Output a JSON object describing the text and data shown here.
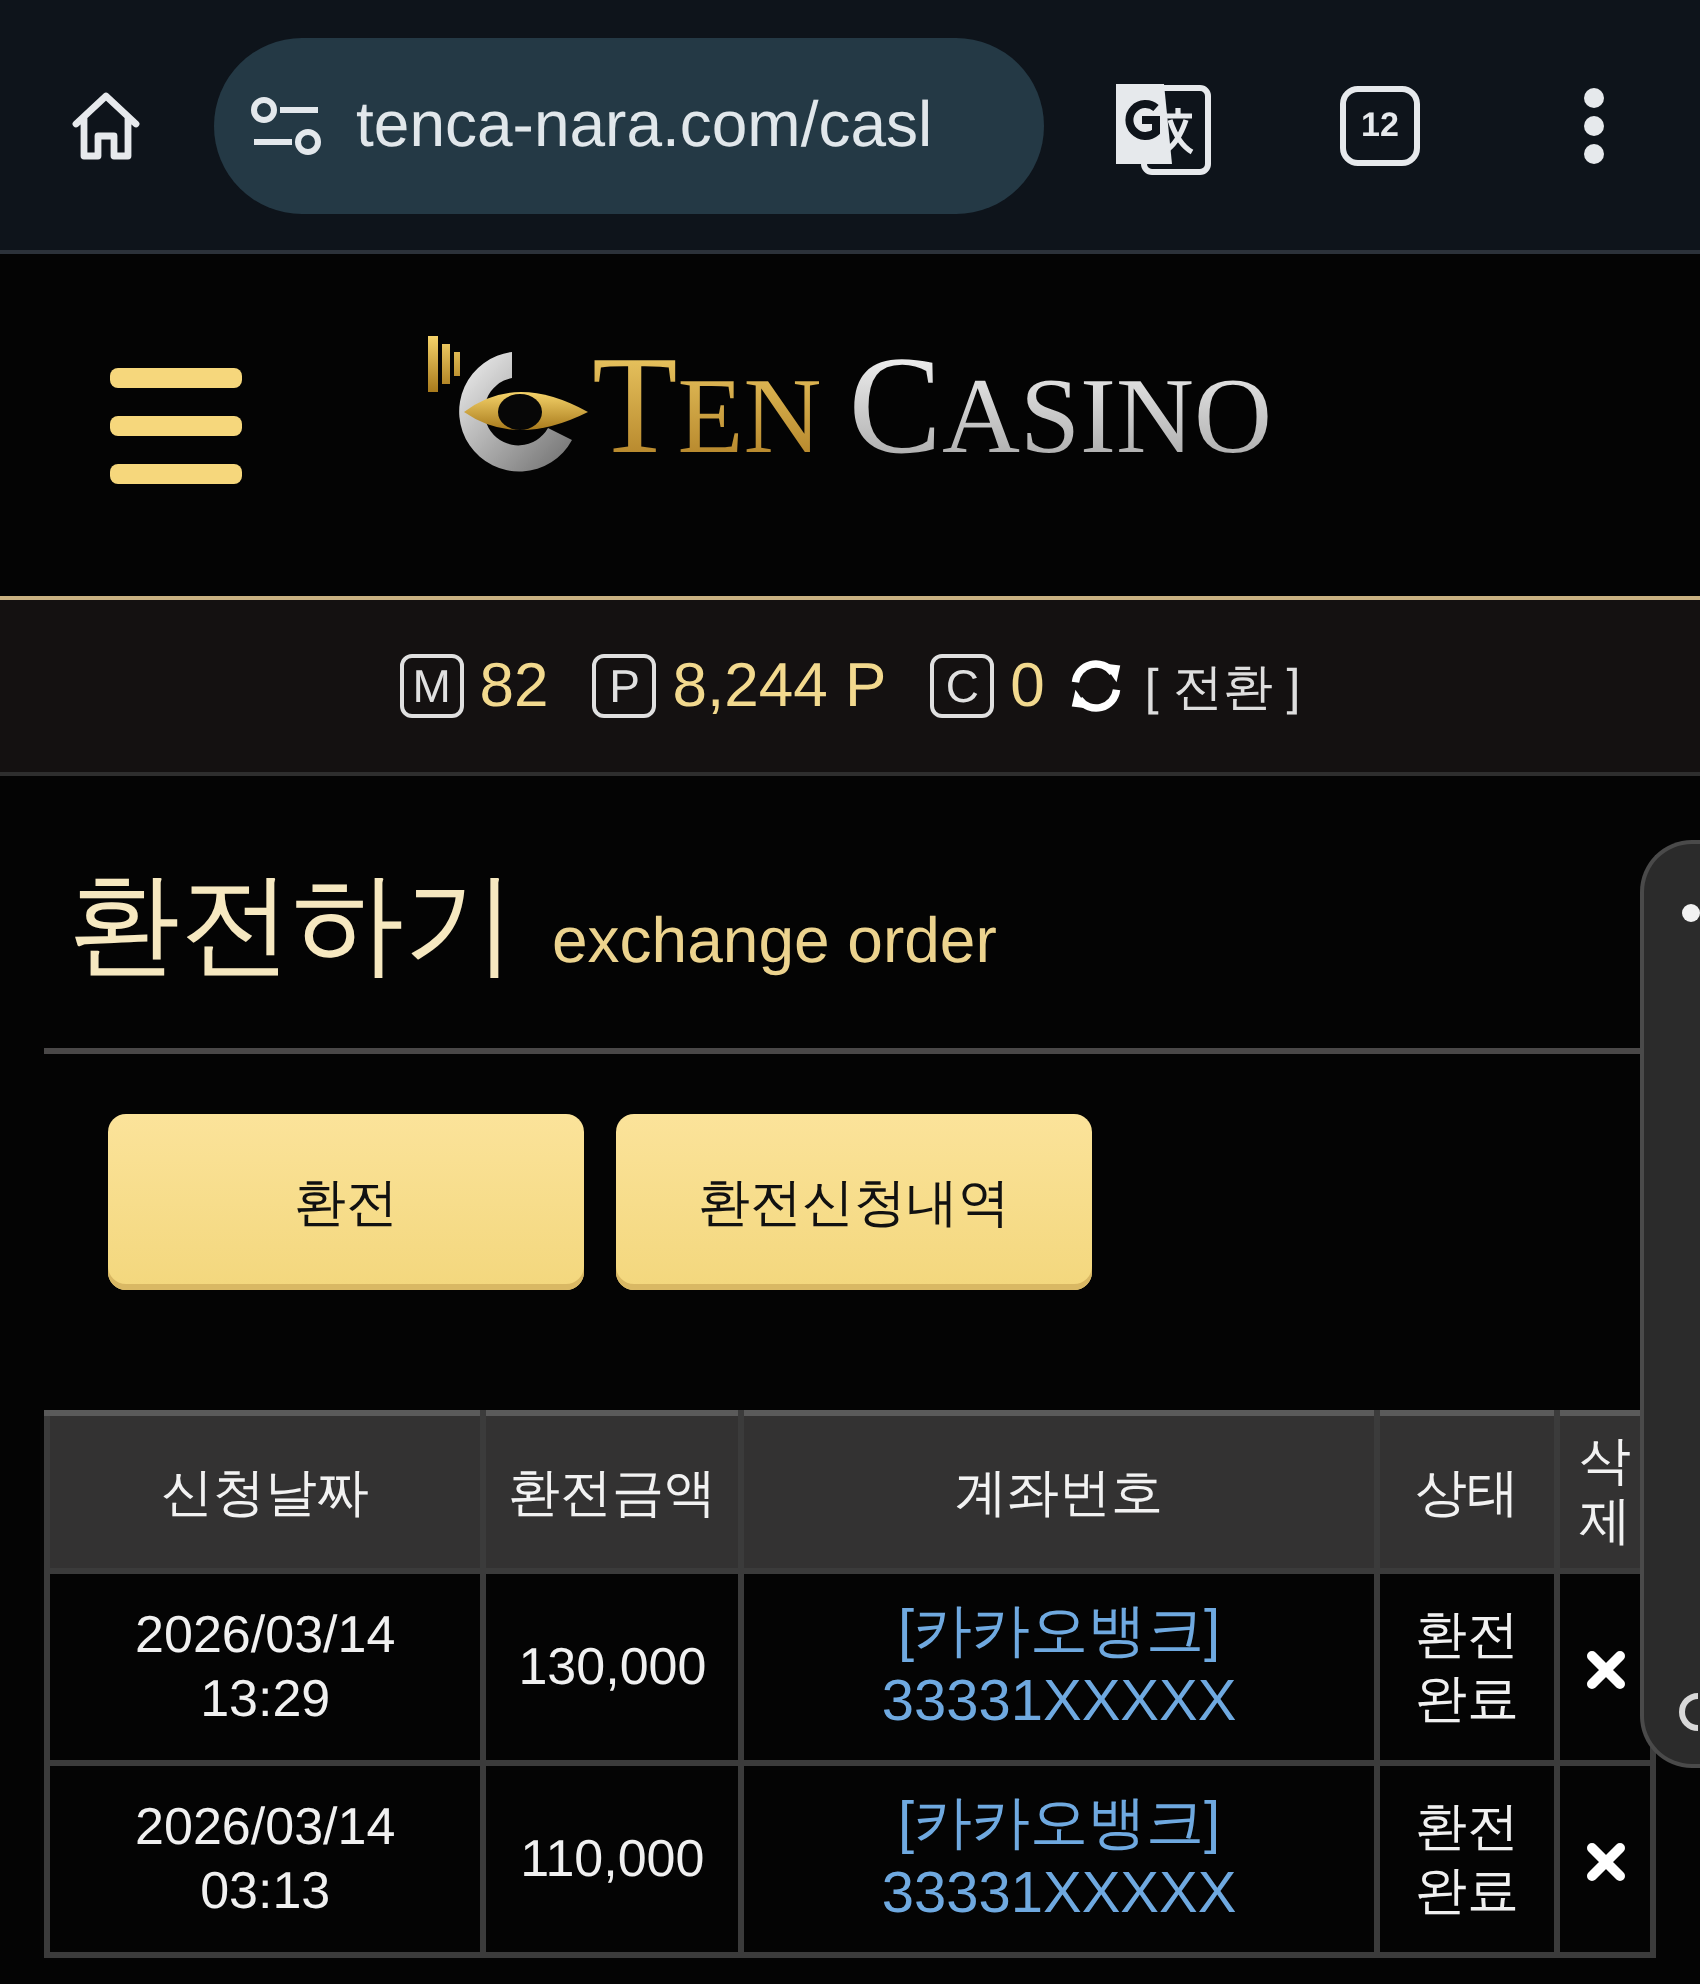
{
  "browser": {
    "url": "tenca-nara.com/casl",
    "tab_count": "12"
  },
  "header": {
    "logo": {
      "first_word": "TEN",
      "second_word": "CASINO"
    }
  },
  "balance_bar": {
    "balances": [
      {
        "badge": "M",
        "value": "82"
      },
      {
        "badge": "P",
        "value": "8,244 P"
      },
      {
        "badge": "C",
        "value": "0"
      }
    ],
    "convert_link": "[ 전환 ]"
  },
  "page_title": {
    "title": "환전하기",
    "subtitle": "exchange order"
  },
  "actions": [
    {
      "label": "환전"
    },
    {
      "label": "환전신청내역"
    }
  ],
  "table": {
    "columns": [
      "신청날짜",
      "환전금액",
      "계좌번호",
      "상태",
      "삭제"
    ],
    "rows": [
      {
        "date": "2026/03/14",
        "time": "13:29",
        "amount": "130,000",
        "bank": "[카카오뱅크]",
        "account": "33331XXXXX",
        "status": "환전완료"
      },
      {
        "date": "2026/03/14",
        "time": "03:13",
        "amount": "110,000",
        "bank": "[카카오뱅크]",
        "account": "33331XXXXX",
        "status": "환전완료"
      }
    ]
  }
}
